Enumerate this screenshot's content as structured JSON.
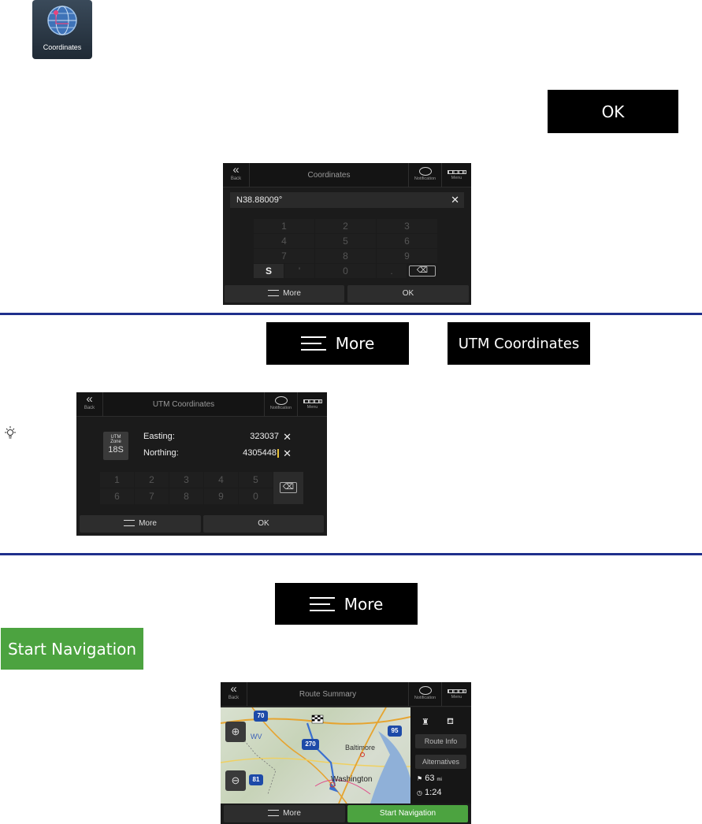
{
  "app_icon": {
    "label": "Coordinates"
  },
  "callouts": {
    "ok": "OK",
    "more_1": "More",
    "utm": "UTM Coordinates",
    "more_2": "More",
    "start_navigation": "Start Navigation"
  },
  "coordinates_screen": {
    "back": "Back",
    "title": "Coordinates",
    "notification": "Notification",
    "menu": "Menu",
    "field_value": "N38.88009°",
    "keys": [
      [
        "1",
        "2",
        "3"
      ],
      [
        "4",
        "5",
        "6"
      ],
      [
        "7",
        "8",
        "9"
      ],
      [
        "S",
        "'",
        "0",
        "."
      ]
    ],
    "more": "More",
    "ok": "OK"
  },
  "utm_screen": {
    "back": "Back",
    "title": "UTM Coordinates",
    "notification": "Notification",
    "menu": "Menu",
    "zone_label_1": "UTM",
    "zone_label_2": "Zone",
    "zone_value": "18S",
    "easting_label": "Easting:",
    "easting_value": "323037",
    "northing_label": "Northing:",
    "northing_value": "4305448",
    "keys": [
      [
        "1",
        "2",
        "3",
        "4",
        "5"
      ],
      [
        "6",
        "7",
        "8",
        "9",
        "0"
      ]
    ],
    "more": "More",
    "ok": "OK"
  },
  "route_screen": {
    "back": "Back",
    "title": "Route Summary",
    "notification": "Notification",
    "menu": "Menu",
    "route_info": "Route Info",
    "alternatives": "Alternatives",
    "distance": "63",
    "distance_unit": "mi",
    "time": "1:24",
    "map_labels": {
      "wv": "WV",
      "baltimore": "Baltimore",
      "washington": "Washington",
      "i70": "70",
      "i270": "270",
      "i95": "95",
      "i81": "81"
    },
    "more": "More",
    "start_navigation": "Start Navigation"
  }
}
